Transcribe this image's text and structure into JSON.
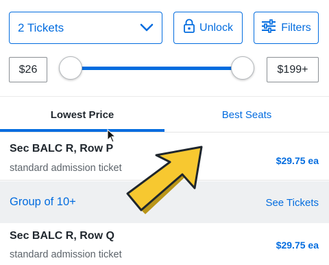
{
  "quantity": {
    "selected": "2 Tickets",
    "icon": "chevron-down-icon"
  },
  "unlock": {
    "label": "Unlock",
    "icon": "lock-icon"
  },
  "filters": {
    "label": "Filters",
    "icon": "sliders-icon"
  },
  "price_range": {
    "min_label": "$26",
    "max_label": "$199+",
    "min_fraction": 0.0,
    "max_fraction": 1.0
  },
  "tabs": [
    {
      "label": "Lowest Price",
      "active": true
    },
    {
      "label": "Best Seats",
      "active": false
    }
  ],
  "listings": [
    {
      "section": "Sec BALC R, Row P",
      "description": "standard admission ticket",
      "price": "$29.75 ea"
    },
    {
      "section": "Sec BALC R, Row Q",
      "description": "standard admission ticket",
      "price": "$29.75 ea"
    }
  ],
  "group_row": {
    "label": "Group of 10+",
    "link": "See Tickets"
  },
  "colors": {
    "accent": "#026cdf",
    "arrow_fill": "#f7c830",
    "group_bg": "#eef0f2",
    "text": "#1f262d"
  }
}
